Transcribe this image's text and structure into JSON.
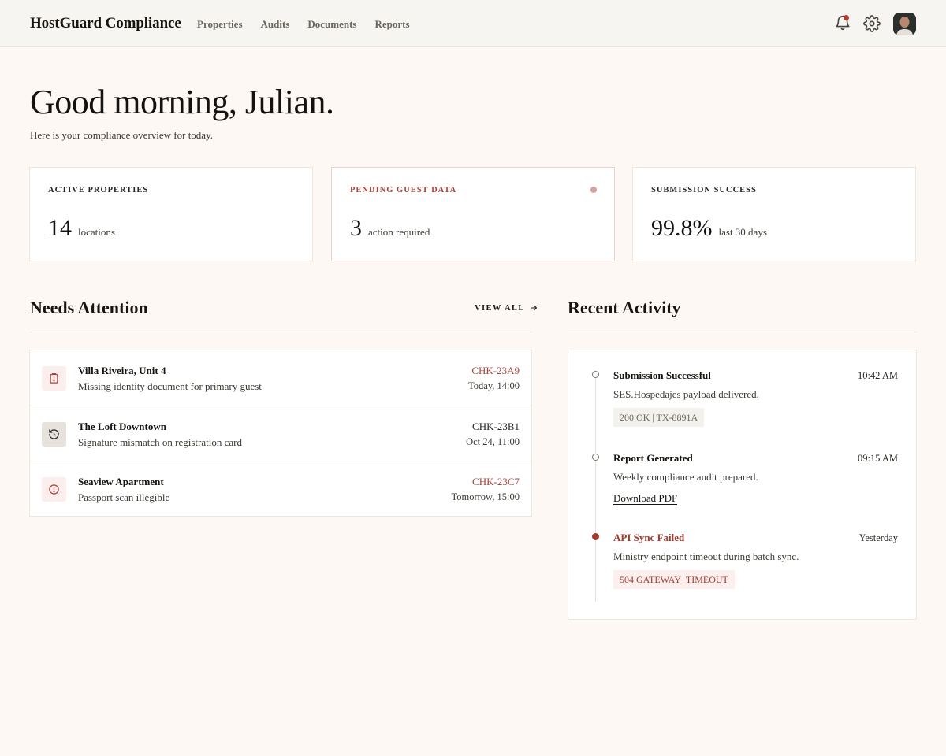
{
  "app": {
    "brand": "HostGuard Compliance"
  },
  "nav": {
    "links": [
      "Properties",
      "Audits",
      "Documents",
      "Reports"
    ],
    "icons": [
      "bell-icon",
      "gear-icon"
    ],
    "notification_color": "#b5372b"
  },
  "greeting": {
    "title": "Good morning, Julian.",
    "subtitle": "Here is your compliance overview for today."
  },
  "stats": [
    {
      "label": "ACTIVE PROPERTIES",
      "value": "14",
      "unit": "locations"
    },
    {
      "label": "PENDING GUEST DATA",
      "value": "3",
      "unit": "action required",
      "accent": "#a8453b"
    },
    {
      "label": "SUBMISSION SUCCESS",
      "value": "99.8%",
      "unit": "last 30 days"
    }
  ],
  "needs_attention": {
    "title": "Needs Attention",
    "view_all": "VIEW ALL",
    "items": [
      {
        "title": "Villa Riveira, Unit 4",
        "description": "Missing identity document for primary guest",
        "code": "CHK-23A9",
        "time": "Today, 14:00",
        "icon": "clipboard-alert-icon",
        "severity": "high"
      },
      {
        "title": "The Loft Downtown",
        "description": "Signature mismatch on registration card",
        "code": "CHK-23B1",
        "time": "Oct 24, 11:00",
        "icon": "history-icon",
        "severity": "normal"
      },
      {
        "title": "Seaview Apartment",
        "description": "Passport scan illegible",
        "code": "CHK-23C7",
        "time": "Tomorrow, 15:00",
        "icon": "alert-circle-icon",
        "severity": "high"
      }
    ]
  },
  "recent_activity": {
    "title": "Recent Activity",
    "items": [
      {
        "title": "Submission Successful",
        "time": "10:42 AM",
        "description": "SES.Hospedajes payload delivered.",
        "chip": "200 OK | TX-8891A",
        "status": "ok"
      },
      {
        "title": "Report Generated",
        "time": "09:15 AM",
        "description": "Weekly compliance audit prepared.",
        "link": "Download PDF",
        "status": "ok"
      },
      {
        "title": "API Sync Failed",
        "time": "Yesterday",
        "description": "Ministry endpoint timeout during batch sync.",
        "chip": "504 GATEWAY_TIMEOUT",
        "status": "error"
      }
    ]
  }
}
